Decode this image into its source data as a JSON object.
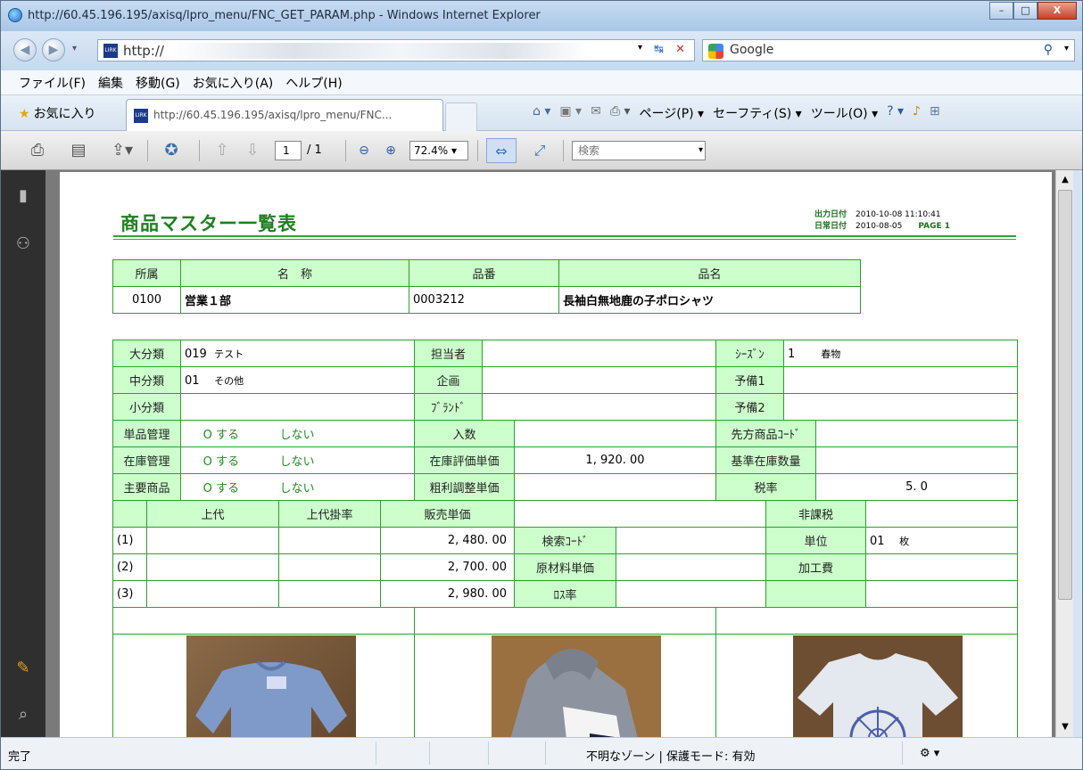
{
  "window": {
    "title": "http://60.45.196.195/axisq/lpro_menu/FNC_GET_PARAM.php - Windows Internet Explorer",
    "minimize": "–",
    "maximize": "□",
    "close": "X"
  },
  "address": {
    "url": "http://",
    "search_engine": "Google"
  },
  "menu": [
    "ファイル(F)",
    "編集",
    "移動(G)",
    "お気に入り(A)",
    "ヘルプ(H)"
  ],
  "favorites_label": "お気に入り",
  "tab_label": "http://60.45.196.195/axisq/lpro_menu/FNC...",
  "commands": [
    "ページ(P) ▾",
    "セーフティ(S) ▾",
    "ツール(O) ▾"
  ],
  "pdf_toolbar": {
    "page_current": "1",
    "page_total": "/ 1",
    "zoom": "72.4%",
    "search_placeholder": "検索"
  },
  "status": {
    "left": "完了",
    "zone": "不明なゾーン | 保護モード: 有効"
  },
  "report": {
    "title": "商品マスター一覧表",
    "output_date_label": "出力日付",
    "output_date": "2010-10-08 11:10:41",
    "daily_date_label": "日常日付",
    "daily_date": "2010-08-05",
    "page_label": "PAGE 1",
    "header_table": {
      "cols": [
        "所属",
        "名　称",
        "品番",
        "品名"
      ],
      "row": [
        "0100",
        "営業１部",
        "0003212",
        "長袖白無地鹿の子ポロシャツ"
      ]
    },
    "detail": {
      "dai_bunrui_label": "大分類",
      "dai_bunrui_code": "019",
      "dai_bunrui_name": "テスト",
      "tantousha_label": "担当者",
      "season_label": "ｼｰｽﾞﾝ",
      "season_code": "1",
      "season_name": "春物",
      "chu_bunrui_label": "中分類",
      "chu_bunrui_code": "01",
      "chu_bunrui_name": "その他",
      "kikaku_label": "企画",
      "yobi1_label": "予備1",
      "sho_bunrui_label": "小分類",
      "brand_label": "ﾌﾞﾗﾝﾄﾞ",
      "yobi2_label": "予備2",
      "tanpin_label": "単品管理",
      "zaiko_label": "在庫管理",
      "shuyou_label": "主要商品",
      "radio_yes": "O する",
      "radio_no": "しない",
      "irisu_label": "入数",
      "hyouka_label": "在庫評価単価",
      "hyouka_value": "1, 920. 00",
      "arari_label": "粗利調整単価",
      "sakikata_label": "先方商品ｺｰﾄﾞ",
      "kijun_label": "基準在庫数量",
      "zeiritsu_label": "税率",
      "zeiritsu_value": "5. 0",
      "hikazei_label": "非課税",
      "joudai_label": "上代",
      "joudai_rate_label": "上代掛率",
      "hanbai_label": "販売単価",
      "rows": [
        {
          "no": "(1)",
          "price": "2, 480. 00",
          "label": "検索ｺｰﾄﾞ",
          "label2": "単位",
          "value2": "01",
          "value2b": "枚"
        },
        {
          "no": "(2)",
          "price": "2, 700. 00",
          "label": "原材料単価",
          "label2": "加工費",
          "value2": "",
          "value2b": ""
        },
        {
          "no": "(3)",
          "price": "2, 980. 00",
          "label": "ﾛｽ率",
          "label2": "",
          "value2": "",
          "value2b": ""
        }
      ]
    }
  },
  "colors": {
    "green_line": "#2e9e2e",
    "header_fill": "#ccffcc",
    "title_green": "#1f7f1f"
  }
}
